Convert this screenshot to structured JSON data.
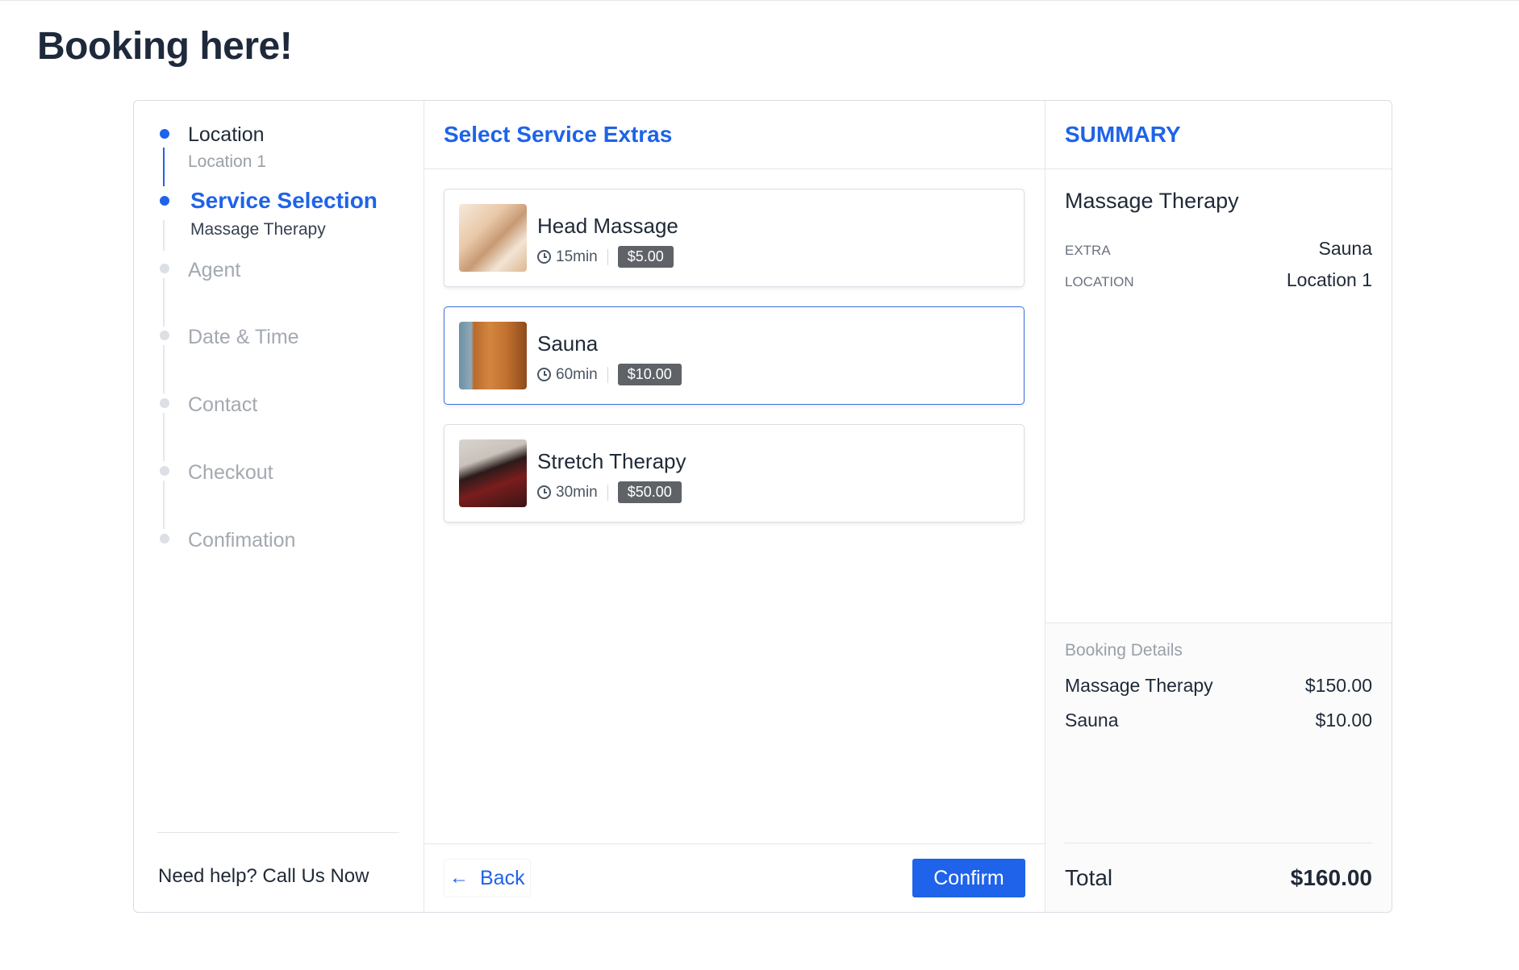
{
  "page": {
    "title": "Booking here!"
  },
  "steps": [
    {
      "label": "Location",
      "sub": "Location 1",
      "state": "done"
    },
    {
      "label": "Service Selection",
      "sub": "Massage Therapy",
      "state": "active"
    },
    {
      "label": "Agent",
      "sub": "",
      "state": "pending"
    },
    {
      "label": "Date & Time",
      "sub": "",
      "state": "pending"
    },
    {
      "label": "Contact",
      "sub": "",
      "state": "pending"
    },
    {
      "label": "Checkout",
      "sub": "",
      "state": "pending"
    },
    {
      "label": "Confimation",
      "sub": "",
      "state": "pending"
    }
  ],
  "help": {
    "text": "Need help? Call Us Now"
  },
  "extras": {
    "title": "Select Service Extras",
    "items": [
      {
        "name": "Head Massage",
        "duration": "15min",
        "price": "$5.00",
        "selected": false
      },
      {
        "name": "Sauna",
        "duration": "60min",
        "price": "$10.00",
        "selected": true
      },
      {
        "name": "Stretch Therapy",
        "duration": "30min",
        "price": "$50.00",
        "selected": false
      }
    ]
  },
  "footer": {
    "back_label": "Back",
    "confirm_label": "Confirm"
  },
  "summary": {
    "title": "SUMMARY",
    "service": "Massage Therapy",
    "rows": [
      {
        "key": "EXTRA",
        "value": "Sauna"
      },
      {
        "key": "LOCATION",
        "value": "Location 1"
      }
    ],
    "booking_details": {
      "title": "Booking Details",
      "lines": [
        {
          "item": "Massage Therapy",
          "price": "$150.00"
        },
        {
          "item": "Sauna",
          "price": "$10.00"
        }
      ]
    },
    "total_label": "Total",
    "total_value": "$160.00"
  },
  "colors": {
    "accent": "#1e63e9",
    "muted": "#a3a9b1",
    "badge": "#5f6368"
  }
}
